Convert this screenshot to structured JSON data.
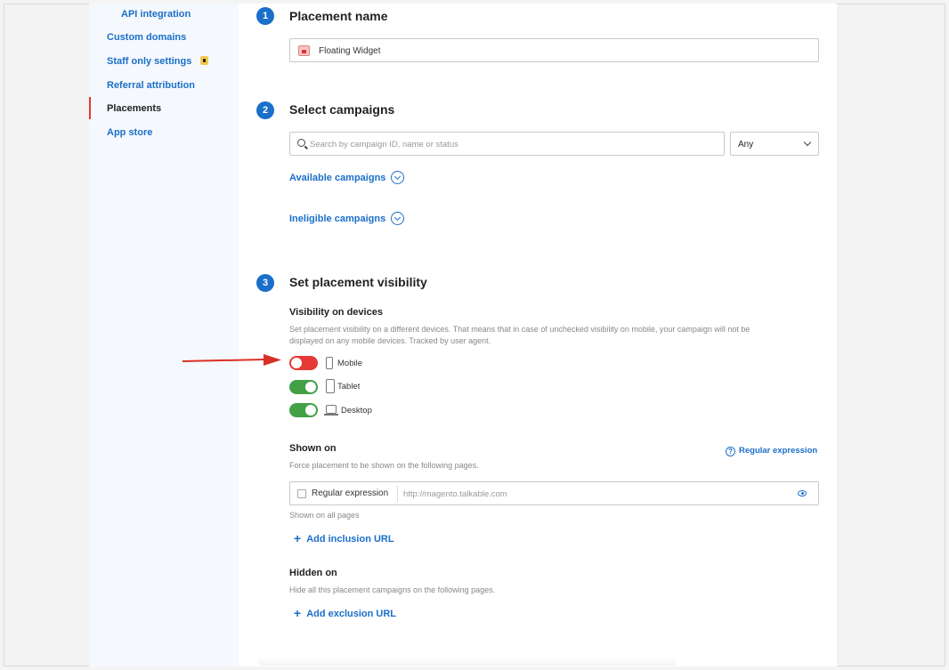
{
  "sidebar": {
    "items": [
      {
        "label": "API integration",
        "sub": true
      },
      {
        "label": "Custom domains"
      },
      {
        "label": "Staff only settings",
        "locked": true
      },
      {
        "label": "Referral attribution"
      },
      {
        "label": "Placements",
        "active": true
      },
      {
        "label": "App store"
      }
    ]
  },
  "step1": {
    "number": "1",
    "title": "Placement name",
    "value": "Floating Widget"
  },
  "step2": {
    "number": "2",
    "title": "Select campaigns",
    "search_placeholder": "Search by campaign ID, name or status",
    "filter_value": "Any",
    "available_label": "Available campaigns",
    "ineligible_label": "Ineligible campaigns"
  },
  "step3": {
    "number": "3",
    "title": "Set placement visibility",
    "devices_heading": "Visibility on devices",
    "devices_help_line1": "Set placement visibility on a different devices. That means that in case of unchecked visibility on mobile, your campaign will not be",
    "devices_help_line2": "displayed on any mobile devices. Tracked by user agent.",
    "devices": [
      {
        "label": "Mobile",
        "enabled": false,
        "icon": "mobile-icon"
      },
      {
        "label": "Tablet",
        "enabled": true,
        "icon": "tablet-icon"
      },
      {
        "label": "Desktop",
        "enabled": true,
        "icon": "laptop-icon"
      }
    ],
    "shown_on": {
      "heading": "Shown on",
      "help": "Force placement to be shown on the following pages.",
      "regex_help_link": "Regular expression",
      "checkbox_label": "Regular expression",
      "url_placeholder": "http://magento.talkable.com",
      "note": "Shown on all pages",
      "add_label": "Add inclusion URL"
    },
    "hidden_on": {
      "heading": "Hidden on",
      "help": "Hide all this placement campaigns on the following pages.",
      "add_label": "Add exclusion URL"
    }
  },
  "colors": {
    "accent": "#1a6fc9",
    "toggle_off": "#e53935",
    "toggle_on": "#43a047",
    "annotation_arrow": "#d93025"
  }
}
